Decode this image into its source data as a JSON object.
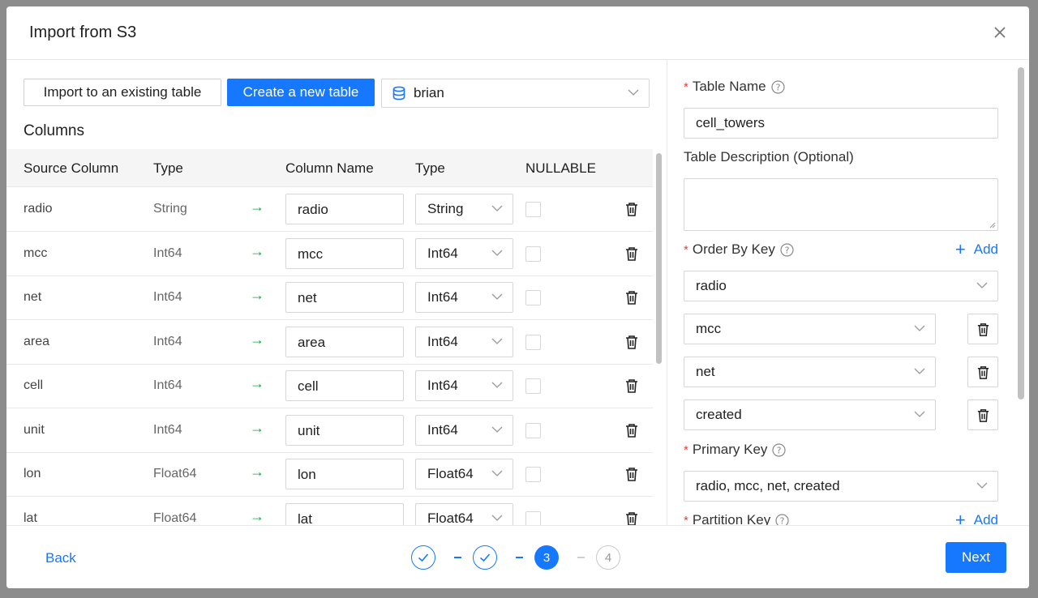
{
  "dialog": {
    "title": "Import from S3"
  },
  "mode_buttons": {
    "existing": "Import to an existing table",
    "new": "Create a new table"
  },
  "database_select": {
    "value": "brian"
  },
  "columns_section": {
    "title": "Columns"
  },
  "columns_table": {
    "headers": [
      "Source Column",
      "Type",
      "Column Name",
      "Type",
      "NULLABLE"
    ],
    "rows": [
      {
        "source": "radio",
        "source_type": "String",
        "name": "radio",
        "type": "String",
        "nullable": false
      },
      {
        "source": "mcc",
        "source_type": "Int64",
        "name": "mcc",
        "type": "Int64",
        "nullable": false
      },
      {
        "source": "net",
        "source_type": "Int64",
        "name": "net",
        "type": "Int64",
        "nullable": false
      },
      {
        "source": "area",
        "source_type": "Int64",
        "name": "area",
        "type": "Int64",
        "nullable": false
      },
      {
        "source": "cell",
        "source_type": "Int64",
        "name": "cell",
        "type": "Int64",
        "nullable": false
      },
      {
        "source": "unit",
        "source_type": "Int64",
        "name": "unit",
        "type": "Int64",
        "nullable": false
      },
      {
        "source": "lon",
        "source_type": "Float64",
        "name": "lon",
        "type": "Float64",
        "nullable": false
      },
      {
        "source": "lat",
        "source_type": "Float64",
        "name": "lat",
        "type": "Float64",
        "nullable": false
      }
    ],
    "arrow": "→"
  },
  "settings": {
    "table_name": {
      "label": "Table Name",
      "value": "cell_towers"
    },
    "table_description": {
      "label": "Table Description (Optional)",
      "value": ""
    },
    "order_by": {
      "label": "Order By Key",
      "add": "Add",
      "keys": [
        "radio",
        "mcc",
        "net",
        "created"
      ]
    },
    "primary_key": {
      "label": "Primary Key",
      "value": "radio, mcc, net, created"
    },
    "partition_key": {
      "label": "Partition Key",
      "add": "Add"
    }
  },
  "footer": {
    "back": "Back",
    "next": "Next",
    "steps": [
      {
        "label": "",
        "state": "done"
      },
      {
        "label": "",
        "state": "done"
      },
      {
        "label": "3",
        "state": "active"
      },
      {
        "label": "4",
        "state": "pending"
      }
    ]
  },
  "colors": {
    "primary": "#1677ff",
    "arrow": "#16a34a",
    "required": "#e53e3e"
  }
}
